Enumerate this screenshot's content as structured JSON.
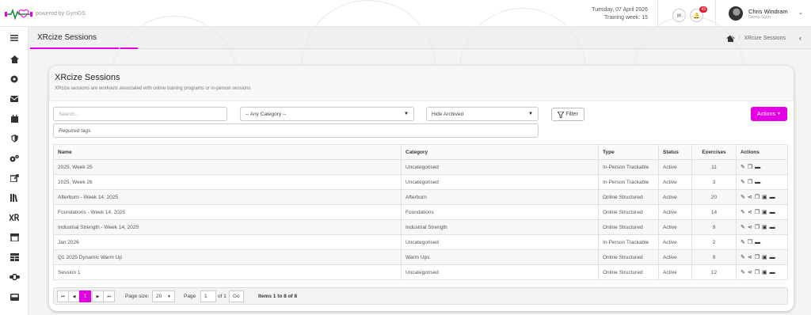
{
  "brand": {
    "powered": "powered by GymOS"
  },
  "header": {
    "date": "Tuesday, 07 April 2026",
    "training_week": "Training week: 15",
    "notification_count": "43",
    "user_name": "Chris Windram",
    "user_gym": "Demo Gym"
  },
  "page": {
    "title": "XRcize Sessions",
    "breadcrumb": "XRcize Sessions"
  },
  "card": {
    "title": "XRcize Sessions",
    "subtitle": "XRcize sessions are workouts associated with online training programs or in-person sessions"
  },
  "filters": {
    "search_placeholder": "Search...",
    "category_value": "-- Any Category --",
    "archived_value": "Hide Archived",
    "filter_label": "Filter",
    "tags_placeholder": "Required tags",
    "actions_label": "Actions"
  },
  "table": {
    "headers": [
      "Name",
      "Category",
      "Type",
      "Status",
      "Exercises",
      "Actions"
    ],
    "rows": [
      {
        "name": "2025, Week 25",
        "category": "Uncategorised",
        "type": "In-Person Trackable",
        "status": "Active",
        "exercises": "11",
        "icons": [
          "pencil-icon",
          "copy-icon",
          "archive-icon"
        ]
      },
      {
        "name": "2025, Week 26",
        "category": "Uncategorised",
        "type": "In-Person Trackable",
        "status": "Active",
        "exercises": "3",
        "icons": [
          "pencil-icon",
          "copy-icon",
          "archive-icon"
        ]
      },
      {
        "name": "Afterburn - Week 14, 2025",
        "category": "Afterburn",
        "type": "Online Structured",
        "status": "Active",
        "exercises": "20",
        "icons": [
          "pencil-icon",
          "share-icon",
          "copy-icon",
          "calendar-icon",
          "archive-icon"
        ]
      },
      {
        "name": "Foundations - Week 14, 2025",
        "category": "Foundations",
        "type": "Online Structured",
        "status": "Active",
        "exercises": "14",
        "icons": [
          "pencil-icon",
          "share-icon",
          "copy-icon",
          "calendar-icon",
          "archive-icon"
        ]
      },
      {
        "name": "Industrial Strength - Week 14, 2025",
        "category": "Industrial Strength",
        "type": "Online Structured",
        "status": "Active",
        "exercises": "9",
        "icons": [
          "pencil-icon",
          "share-icon",
          "copy-icon",
          "calendar-icon",
          "archive-icon"
        ]
      },
      {
        "name": "Jan 2026",
        "category": "Uncategorised",
        "type": "In-Person Trackable",
        "status": "Active",
        "exercises": "2",
        "icons": [
          "pencil-icon",
          "copy-icon",
          "archive-icon"
        ]
      },
      {
        "name": "Q1 2025 Dynamic Warm Up",
        "category": "Warm Ups",
        "type": "Online Structured",
        "status": "Active",
        "exercises": "9",
        "icons": [
          "pencil-icon",
          "share-icon",
          "copy-icon",
          "calendar-icon",
          "archive-icon"
        ]
      },
      {
        "name": "Session 1",
        "category": "Uncategorised",
        "type": "Online Structured",
        "status": "Active",
        "exercises": "12",
        "icons": [
          "pencil-icon",
          "share-icon",
          "copy-icon",
          "calendar-icon",
          "archive-icon"
        ]
      }
    ]
  },
  "pager": {
    "current_page": "1",
    "page_size_label": "Page size:",
    "page_size": "20",
    "page_label": "Page",
    "page_input": "1",
    "of_label": "of 1",
    "go_label": "Go",
    "summary": "Items 1 to 8 of 8"
  },
  "sidebar_icons": [
    "home-icon",
    "dashboard-icon",
    "mail-icon",
    "calendar-icon",
    "shield-icon",
    "settings-icon",
    "export-icon",
    "library-icon",
    "xrcize-icon",
    "store-icon",
    "table-icon",
    "wristband-icon",
    "inbox-icon"
  ],
  "colors": {
    "accent": "#e400e4",
    "badge": "#d9232d"
  }
}
